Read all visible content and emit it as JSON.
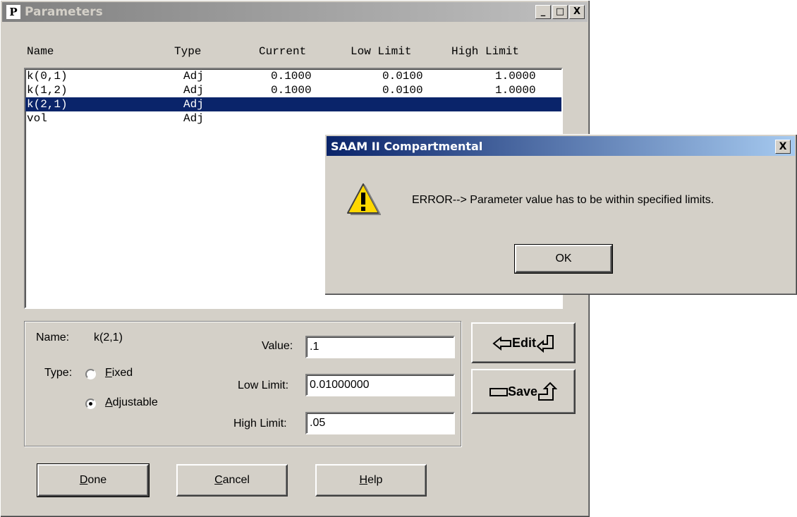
{
  "param_window": {
    "title": "Parameters",
    "app_icon": "P",
    "window_buttons": {
      "minimize": "_",
      "maximize": "□",
      "close": "X"
    },
    "columns": [
      "Name",
      "Type",
      "Current",
      "Low Limit",
      "High Limit"
    ],
    "rows": [
      {
        "name": "k(0,1)",
        "type": "Adj",
        "current": "0.1000",
        "low": "0.0100",
        "high": "1.0000"
      },
      {
        "name": "k(1,2)",
        "type": "Adj",
        "current": "0.1000",
        "low": "0.0100",
        "high": "1.0000"
      },
      {
        "name": "k(2,1)",
        "type": "Adj",
        "current": "",
        "low": "",
        "high": ""
      },
      {
        "name": "vol",
        "type": "Adj",
        "current": "",
        "low": "",
        "high": ""
      }
    ],
    "selected_row": 2,
    "detail": {
      "name_label": "Name:",
      "name_value": "k(2,1)",
      "type_label": "Type:",
      "fixed_prefix": "",
      "fixed_mnemonic": "F",
      "fixed_rest": "ixed",
      "adjustable_mnemonic": "A",
      "adjustable_rest": "djustable",
      "type_selected": "Adjustable",
      "value_label": "Value:",
      "value": ".1",
      "low_limit_label": "Low Limit:",
      "low_limit": "0.01000000",
      "high_limit_label": "High Limit:",
      "high_limit": ".05"
    },
    "side_buttons": {
      "edit": "Edit",
      "save": "Save"
    },
    "buttons": {
      "done_m": "D",
      "done_rest": "one",
      "cancel_m": "C",
      "cancel_rest": "ancel",
      "help_m": "H",
      "help_rest": "elp"
    }
  },
  "error_dialog": {
    "title": "SAAM II Compartmental",
    "close": "X",
    "icon": "warning-icon",
    "message": "ERROR--> Parameter value has to be within specified limits.",
    "ok_label": "OK"
  }
}
